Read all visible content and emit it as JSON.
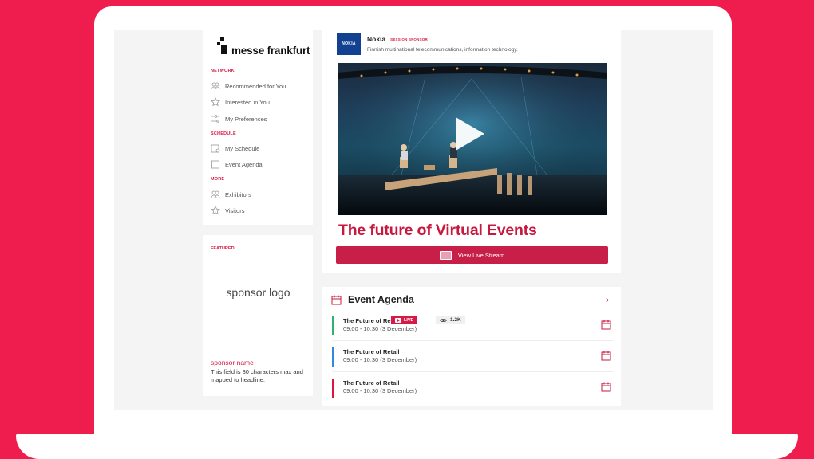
{
  "brand": {
    "logo_text": "messe frankfurt"
  },
  "nav": {
    "sections": [
      {
        "label": "NETWORK",
        "items": [
          {
            "label": "Recommended for You",
            "icon": "people-icon"
          },
          {
            "label": "Interested in You",
            "icon": "star-icon"
          },
          {
            "label": "My Preferences",
            "icon": "preferences-icon"
          }
        ]
      },
      {
        "label": "SCHEDULE",
        "items": [
          {
            "label": "My Schedule",
            "icon": "schedule-icon"
          },
          {
            "label": "Event Agenda",
            "icon": "calendar-icon"
          }
        ]
      },
      {
        "label": "MORE",
        "items": [
          {
            "label": "Exhibitors",
            "icon": "people-icon"
          },
          {
            "label": "Visitors",
            "icon": "star-icon"
          }
        ]
      }
    ]
  },
  "featured": {
    "label": "FEATURED",
    "sponsor_logo": "sponsor logo",
    "sponsor_name": "sponsor name",
    "sponsor_desc": "This field is 80 characters max and mapped to headline."
  },
  "session": {
    "sponsor": {
      "logo_text": "NOKIA",
      "name": "Nokia",
      "badge": "SESSION SPONSOR",
      "description": "Finnish multinational telecommunications, information technology."
    },
    "title": "The future of Virtual Events",
    "button_label": "View Live Stream"
  },
  "agenda": {
    "title": "Event Agenda",
    "chevron": "›",
    "items": [
      {
        "title": "The Future of Retail",
        "time": "09:00 - 10:30 (3 December)",
        "color": "#2db36f",
        "live": "LIVE",
        "views": "1.2K"
      },
      {
        "title": "The Future of Retail",
        "time": "09:00 - 10:30 (3 December)",
        "color": "#2d8ae0"
      },
      {
        "title": "The Future of Retail",
        "time": "09:00 - 10:30 (3 December)",
        "color": "#e0153f"
      }
    ]
  },
  "colors": {
    "background": "#ee1d4d",
    "accent": "#c8183f"
  }
}
